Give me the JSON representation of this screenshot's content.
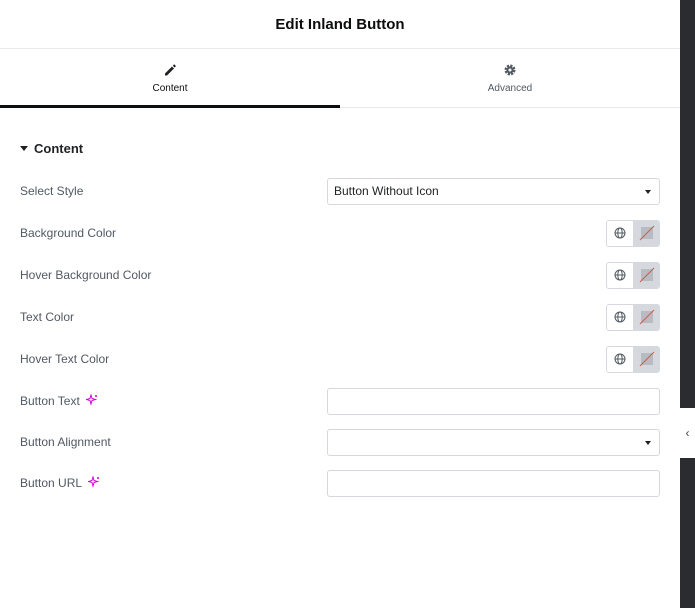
{
  "header": {
    "title": "Edit Inland Button"
  },
  "tabs": [
    {
      "label": "Content",
      "icon": "pencil-icon",
      "active": true
    },
    {
      "label": "Advanced",
      "icon": "gear-icon",
      "active": false
    }
  ],
  "section": {
    "title": "Content"
  },
  "controls": {
    "select_style": {
      "label": "Select Style",
      "value": "Button Without Icon"
    },
    "background_color": {
      "label": "Background Color"
    },
    "hover_background_color": {
      "label": "Hover Background Color"
    },
    "text_color": {
      "label": "Text Color"
    },
    "hover_text_color": {
      "label": "Hover Text Color"
    },
    "button_text": {
      "label": "Button Text",
      "value": ""
    },
    "button_alignment": {
      "label": "Button Alignment",
      "value": ""
    },
    "button_url": {
      "label": "Button URL",
      "value": ""
    }
  },
  "colors": {
    "accent": "#0c0d0e",
    "ai_sparkle": "#d004d4",
    "no_color_slash": "#d9534f"
  },
  "rail": {
    "toggle_glyph": "‹"
  }
}
